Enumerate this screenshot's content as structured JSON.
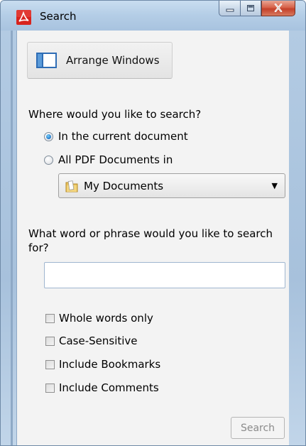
{
  "window": {
    "title": "Search",
    "app_icon": "adobe-reader-icon",
    "controls": {
      "minimize_icon": "minimize-icon",
      "maximize_icon": "maximize-icon",
      "close_icon": "close-icon"
    }
  },
  "toolbar": {
    "arrange_windows_label": "Arrange Windows",
    "arrange_icon": "arrange-windows-icon"
  },
  "location": {
    "question": "Where would you like to search?",
    "options": [
      {
        "label": "In the current document",
        "selected": true
      },
      {
        "label": "All PDF Documents in",
        "selected": false
      }
    ],
    "folder": {
      "label": "My Documents",
      "icon": "folder-icon"
    }
  },
  "query": {
    "question": "What word or phrase would you like to search for?",
    "value": "",
    "placeholder": ""
  },
  "options": [
    {
      "label": "Whole words only",
      "checked": false
    },
    {
      "label": "Case-Sensitive",
      "checked": false
    },
    {
      "label": "Include Bookmarks",
      "checked": false
    },
    {
      "label": "Include Comments",
      "checked": false
    }
  ],
  "actions": {
    "search_label": "Search",
    "search_enabled": false
  },
  "colors": {
    "accent_radio": "#1e74c9",
    "close_button": "#c4402a",
    "disabled_text": "#8a8a8a"
  }
}
